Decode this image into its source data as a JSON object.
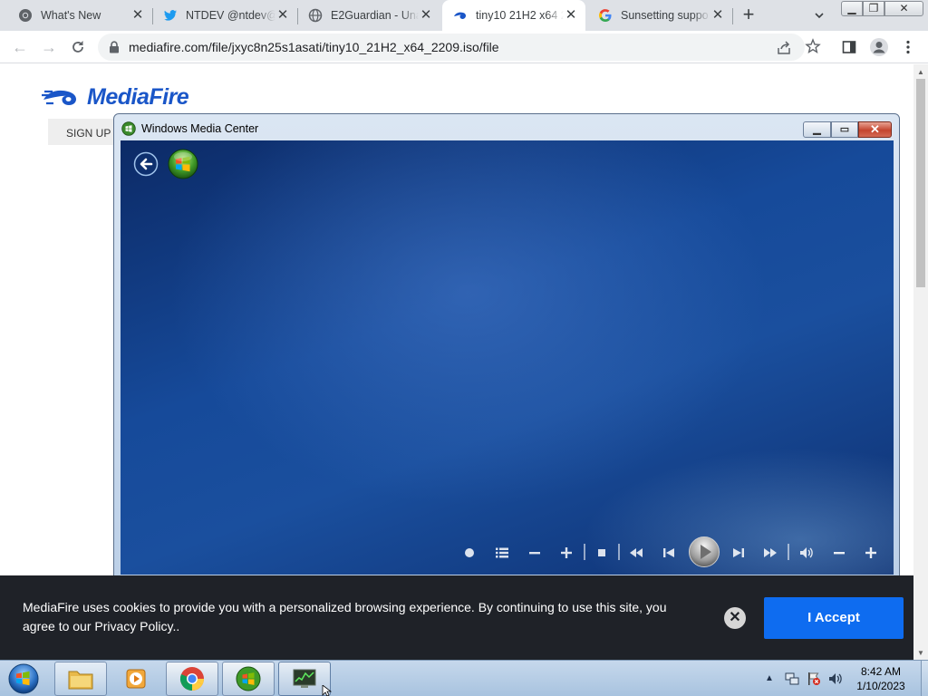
{
  "browser": {
    "tabs": [
      {
        "title": "What's New",
        "icon": "chrome-icon",
        "active": false
      },
      {
        "title": "NTDEV @ntdev@",
        "icon": "twitter-icon",
        "active": false
      },
      {
        "title": "E2Guardian - Una",
        "icon": "globe-icon",
        "active": false
      },
      {
        "title": "tiny10 21H2 x64 2",
        "icon": "mediafire-icon",
        "active": true
      },
      {
        "title": "Sunsetting suppo",
        "icon": "google-icon",
        "active": false
      }
    ],
    "url": "mediafire.com/file/jxyc8n25s1asati/tiny10_21H2_x64_2209.iso/file"
  },
  "page": {
    "logo_text": "MediaFire",
    "signup_label": "SIGN UP"
  },
  "media_center": {
    "title": "Windows Media Center"
  },
  "cookie_banner": {
    "message": "MediaFire uses cookies to provide you with a personalized browsing experience. By continuing to use this site, you agree to our Privacy Policy..",
    "accept_label": "I Accept"
  },
  "taskbar": {
    "time": "8:42 AM",
    "date": "1/10/2023"
  },
  "colors": {
    "mediafire_blue": "#1a56c8",
    "accept_button": "#0e6cf0",
    "cookie_background": "#1f2228",
    "wmc_background": "#164a9a"
  }
}
